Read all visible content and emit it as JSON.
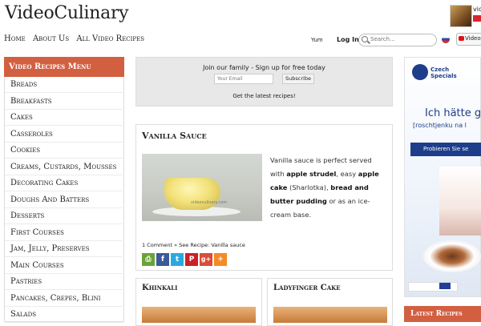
{
  "header": {
    "logo": "VideoCulinary",
    "user_name": "vic"
  },
  "nav": {
    "items": [
      "Home",
      "About Us",
      "All Video Recipes"
    ],
    "yum": "Yum",
    "login": "Log In",
    "search_placeholder": "Search...",
    "youtube_label": "VideoCu"
  },
  "sidebar": {
    "title": "Video Recipes Menu",
    "items": [
      "Breads",
      "Breakfasts",
      "Cakes",
      "Casseroles",
      "Cookies",
      "Creams, Custards, Mousses",
      "Decorating Cakes",
      "Doughs And Batters",
      "Desserts",
      "First Courses",
      "Jam, Jelly, Preserves",
      "Main Courses",
      "Pastries",
      "Pancakes, Crepes, Blini",
      "Salads"
    ]
  },
  "signup": {
    "title": "Join our family - Sign up for free today",
    "email_placeholder": "Your Email",
    "button": "Subscribe",
    "subtitle": "Get the latest recipes!"
  },
  "article": {
    "title": "Vanilla Sauce",
    "watermark": "videoculinary.com",
    "desc_1": "Vanilla sauce is perfect served with ",
    "bold_1": "apple strudel",
    "desc_2": ", easy ",
    "bold_2": "apple cake",
    "desc_3": " (Sharlotka), ",
    "bold_3": "bread and butter pudding",
    "desc_4": " or as an ice-cream base.",
    "meta": "1 Comment  »  See Recipe: Vanilla sauce",
    "share_buttons": [
      "print-icon",
      "facebook-icon",
      "twitter-icon",
      "pinterest-icon",
      "google-plus-icon",
      "more-icon"
    ],
    "share_glyphs": [
      "⎙",
      "f",
      "t",
      "P",
      "g+",
      "+"
    ],
    "share_colors": [
      "#6aa339",
      "#3b5998",
      "#2aa9e0",
      "#cb2027",
      "#dd4b39",
      "#f58b24"
    ]
  },
  "cards": [
    {
      "title": "Khinkali"
    },
    {
      "title": "Ladyfinger Cake"
    }
  ],
  "ad": {
    "brand": "Czech Specials",
    "headline": "Ich hätte g",
    "subline": "[roschtjenku na l",
    "button": "Probieren Sie se"
  },
  "latest": "Latest Recipes"
}
